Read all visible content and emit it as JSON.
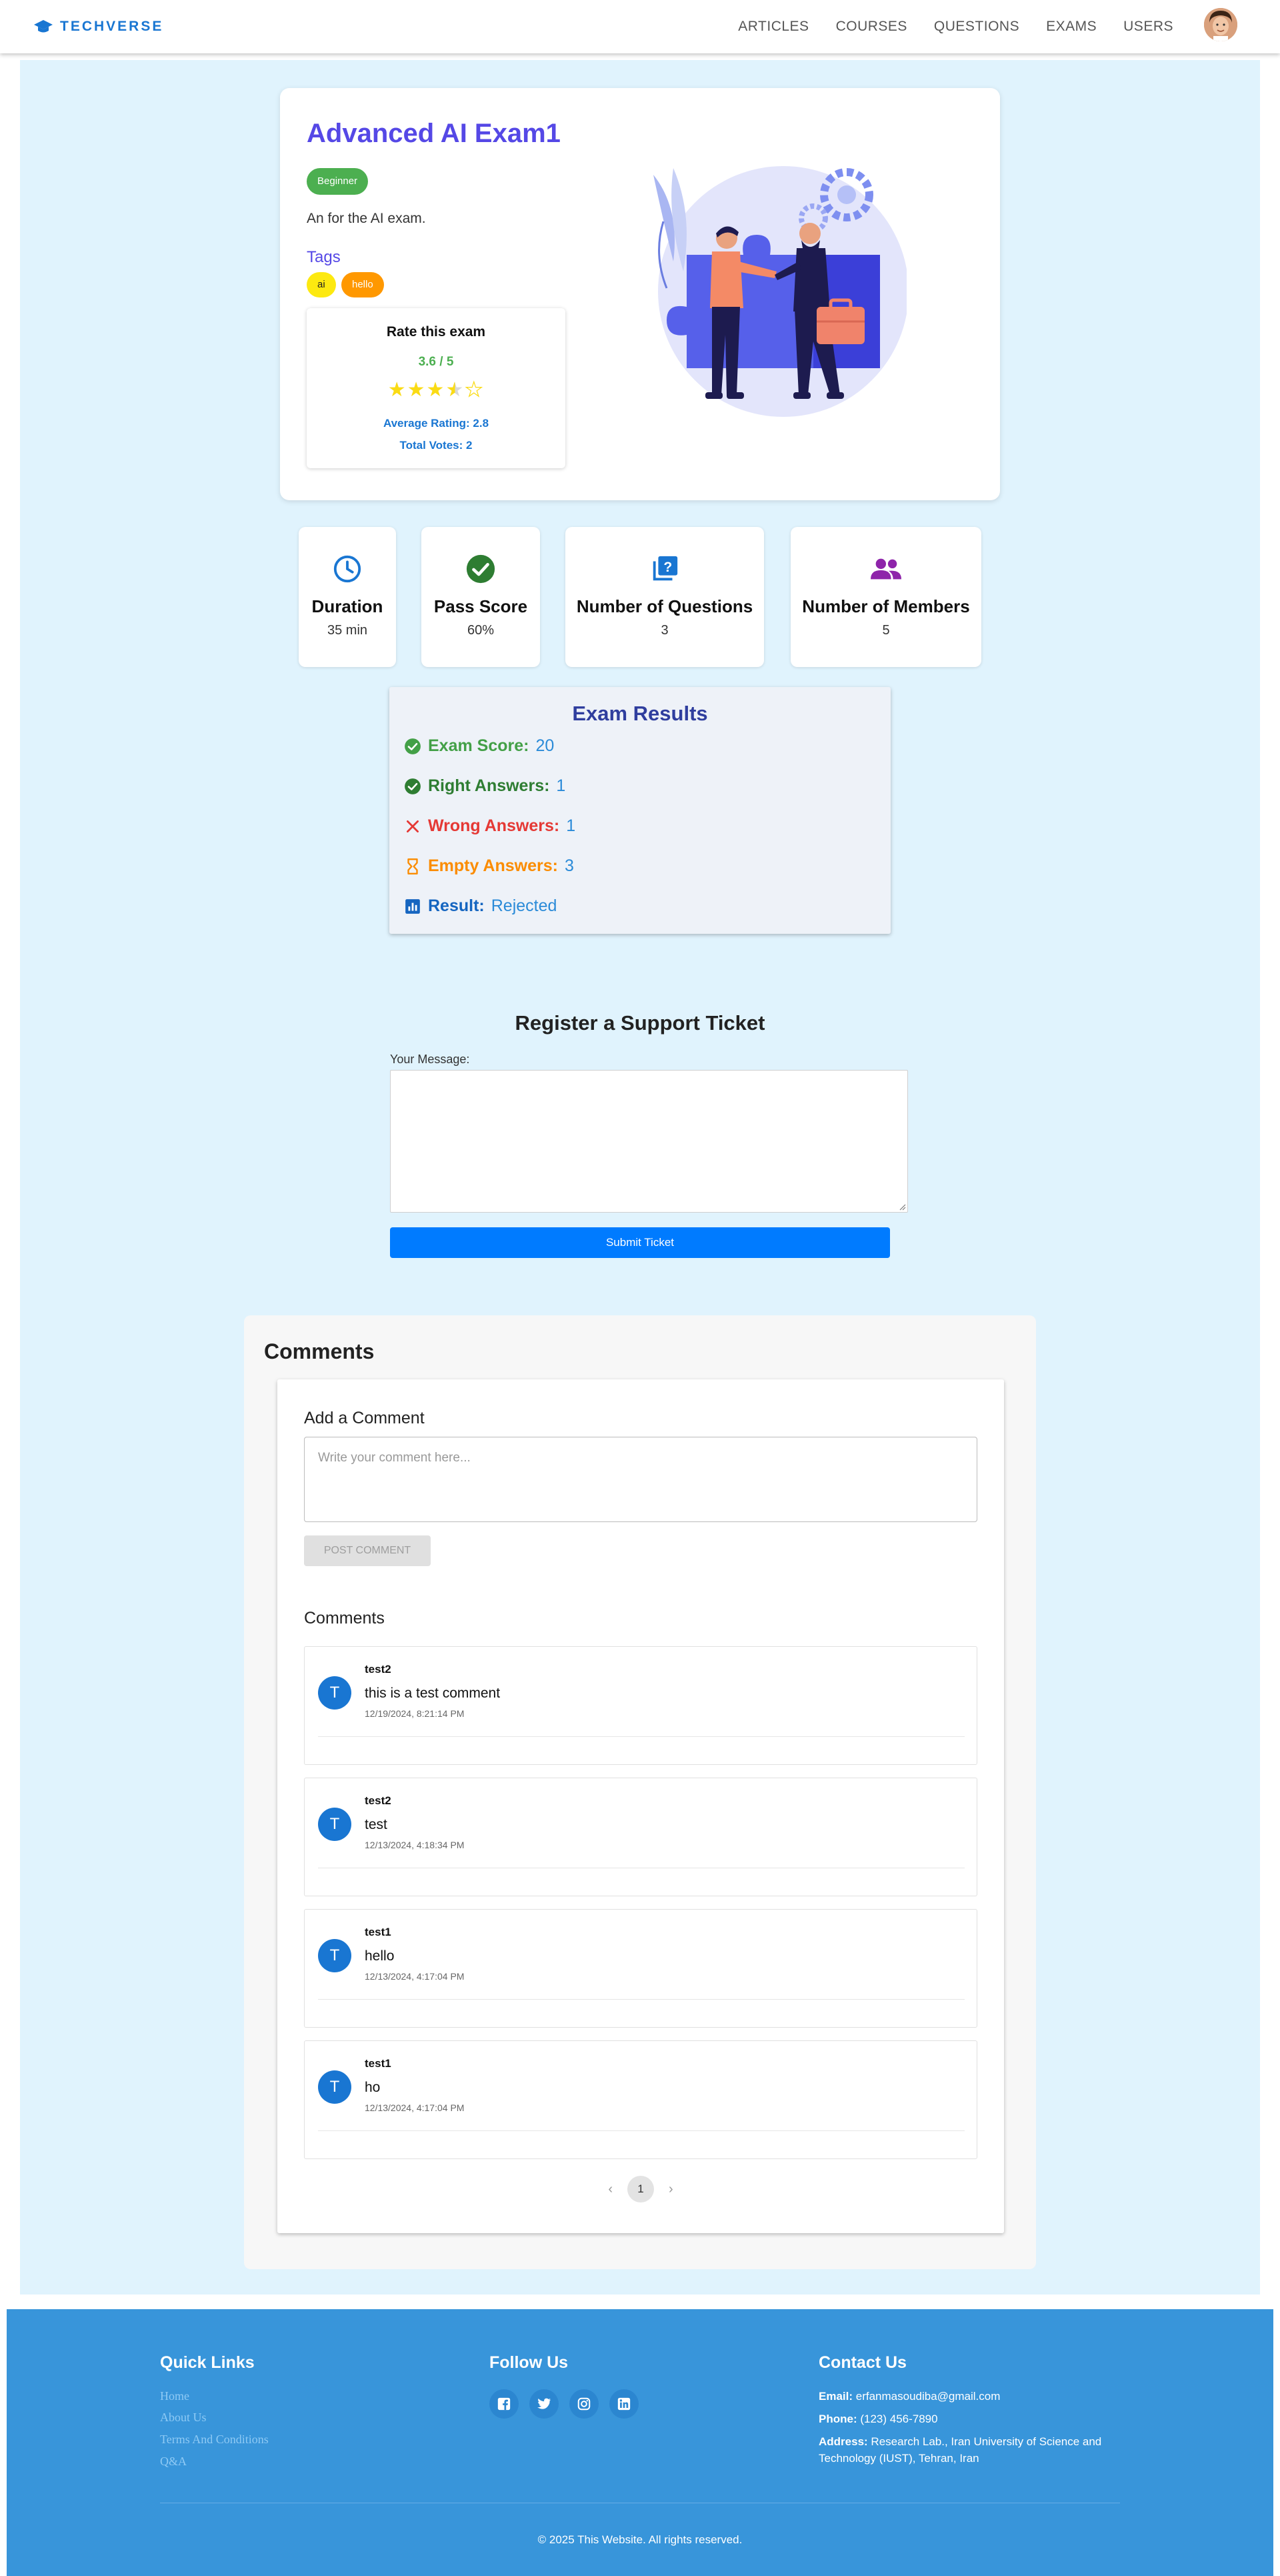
{
  "brand": {
    "name": "TECHVERSE",
    "color": "#1976d2"
  },
  "nav": {
    "items": [
      "ARTICLES",
      "COURSES",
      "QUESTIONS",
      "EXAMS",
      "USERS"
    ]
  },
  "exam": {
    "title": "Advanced AI Exam1",
    "level": "Beginner",
    "description": "An for the AI exam.",
    "tags_label": "Tags",
    "tags": [
      "ai",
      "hello"
    ]
  },
  "rating": {
    "title": "Rate this exam",
    "score": "3.6 / 5",
    "stars_value": 3.5,
    "stars_max": 5,
    "average": "Average Rating: 2.8",
    "votes": "Total Votes: 2"
  },
  "stats": [
    {
      "label": "Duration",
      "value": "35 min",
      "icon": "clock-icon"
    },
    {
      "label": "Pass Score",
      "value": "60%",
      "icon": "check-circle-icon"
    },
    {
      "label": "Number of Questions",
      "value": "3",
      "icon": "quiz-icon"
    },
    {
      "label": "Number of Members",
      "value": "5",
      "icon": "people-icon"
    }
  ],
  "results": {
    "title": "Exam Results",
    "rows": [
      {
        "label": "Exam Score:",
        "value": "20",
        "color": "#43a047",
        "icon": "check-circle-icon"
      },
      {
        "label": "Right Answers:",
        "value": "1",
        "color": "#2e7d32",
        "icon": "check-circle-icon"
      },
      {
        "label": "Wrong Answers:",
        "value": "1",
        "color": "#e53935",
        "icon": "close-icon"
      },
      {
        "label": "Empty Answers:",
        "value": "3",
        "color": "#fb8c00",
        "icon": "hourglass-icon"
      },
      {
        "label": "Result:",
        "value": "Rejected",
        "color": "#1565c0",
        "icon": "bar-chart-icon"
      }
    ]
  },
  "ticket": {
    "title": "Register a Support Ticket",
    "label": "Your Message:",
    "submit": "Submit Ticket"
  },
  "comments": {
    "heading": "Comments",
    "add_title": "Add a Comment",
    "placeholder": "Write your comment here...",
    "post_button": "POST COMMENT",
    "list_title": "Comments",
    "items": [
      {
        "avatar": "T",
        "author": "test2",
        "text": "this is a test comment",
        "date": "12/19/2024, 8:21:14 PM"
      },
      {
        "avatar": "T",
        "author": "test2",
        "text": "test",
        "date": "12/13/2024, 4:18:34 PM"
      },
      {
        "avatar": "T",
        "author": "test1",
        "text": "hello",
        "date": "12/13/2024, 4:17:04 PM"
      },
      {
        "avatar": "T",
        "author": "test1",
        "text": "ho",
        "date": "12/13/2024, 4:17:04 PM"
      }
    ],
    "page": "1"
  },
  "footer": {
    "quick_links_title": "Quick Links",
    "links": [
      "Home",
      "About Us",
      "Terms And Conditions",
      "Q&A"
    ],
    "follow_title": "Follow Us",
    "social": [
      "facebook-icon",
      "twitter-icon",
      "instagram-icon",
      "linkedin-icon"
    ],
    "contact_title": "Contact Us",
    "email_label": "Email:",
    "email": "erfanmasoudiba@gmail.com",
    "phone_label": "Phone:",
    "phone": "(123) 456-7890",
    "address_label": "Address:",
    "address": "Research Lab., Iran University of Science and Technology (IUST), Tehran, Iran",
    "copyright": "© 2025 This Website. All rights reserved."
  }
}
